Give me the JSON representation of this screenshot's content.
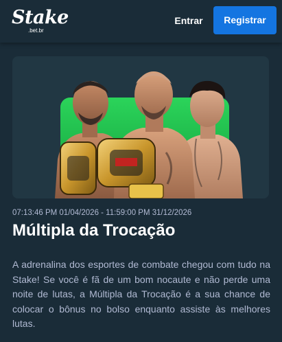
{
  "header": {
    "logo_text": "Stake",
    "logo_subtext": ".bet.br",
    "login_label": "Entrar",
    "register_label": "Registrar"
  },
  "promo": {
    "banner_image": "ufc-fighters-belts-banner",
    "date_range": "07:13:46 PM 01/04/2026 - 11:59:00 PM 31/12/2026",
    "title": "Múltipla da Trocação",
    "description": "A adrenalina dos esportes de combate chegou com tudo na Stake! Se você é fã de um bom nocaute e não perde uma noite de lutas, a Múltipla da Trocação é a sua chance de colocar o bônus no bolso enquanto assiste às melhores lutas."
  },
  "colors": {
    "page_bg": "#0f212e",
    "panel_bg": "#1a2c38",
    "primary_button": "#1475e1",
    "banner_green": "#1fb84a",
    "muted_text": "#b1bad3"
  }
}
